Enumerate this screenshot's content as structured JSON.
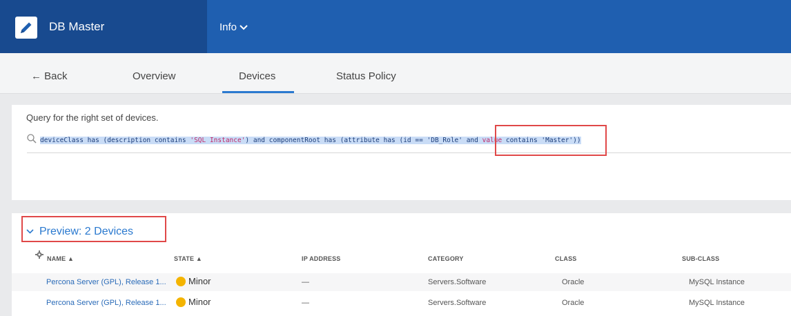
{
  "header": {
    "app_title": "DB Master",
    "menu_label": "Info",
    "accent_color": "#1f5fb0",
    "brand_color": "#184a8f"
  },
  "tabs": [
    {
      "label": "← Back"
    },
    {
      "label": "Overview"
    },
    {
      "label": "Devices",
      "active": true
    },
    {
      "label": "Status Policy"
    }
  ],
  "query": {
    "hint": "Query for the right set of devices.",
    "parts": {
      "p1": "deviceClass has (description contains ",
      "s1": "'SQL Instance'",
      "p2": ") and componentRoot has (attribute has (id == 'DB_Role' and ",
      "k1": "value",
      "p3": " contains 'Master'))"
    }
  },
  "preview": {
    "title": "Preview: 2 Devices",
    "columns": [
      "NAME ▲",
      "STATE ▲",
      "IP ADDRESS",
      "CATEGORY",
      "CLASS",
      "SUB-CLASS"
    ],
    "rows": [
      {
        "name": "Percona Server (GPL), Release 1...",
        "state": "Minor",
        "ip": "—",
        "category": "Servers.Software",
        "class": "Oracle",
        "subclass": "MySQL Instance"
      },
      {
        "name": "Percona Server (GPL), Release 1...",
        "state": "Minor",
        "ip": "—",
        "category": "Servers.Software",
        "class": "Oracle",
        "subclass": "MySQL Instance"
      }
    ],
    "state_color": "#f4b400"
  },
  "icons": {
    "brand": "pencil-icon",
    "search": "search-icon",
    "settings": "gear-icon",
    "menu_chevron": "chevron-down-icon",
    "preview_chevron": "chevron-down-icon"
  }
}
